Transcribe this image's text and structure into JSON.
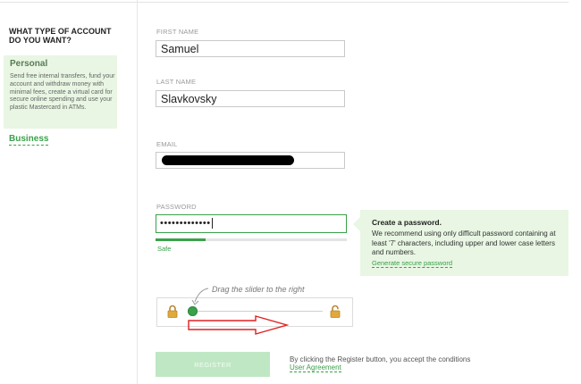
{
  "sidebar": {
    "heading": "WHAT TYPE OF ACCOUNT DO YOU WANT?",
    "options": [
      {
        "label": "Personal",
        "description": "Send free internal transfers, fund your account and withdraw money with minimal fees, create a virtual card for secure online spending and use your plastic Mastercard in ATMs.",
        "selected": true
      },
      {
        "label": "Business",
        "selected": false
      }
    ]
  },
  "form": {
    "first_name": {
      "label": "FIRST NAME",
      "value": "Samuel"
    },
    "last_name": {
      "label": "LAST NAME",
      "value": "Slavkovsky"
    },
    "email": {
      "label": "EMAIL",
      "value": ""
    },
    "password": {
      "label": "PASSWORD",
      "masked_value": "•••••••••••••",
      "strength_label": "Safe",
      "strength_fraction": 0.26
    }
  },
  "password_tip": {
    "title": "Create a password.",
    "text": "We recommend using only difficult password containing at least '7' characters, including upper and lower case letters and numbers.",
    "generate_link": "Generate secure password"
  },
  "captcha": {
    "hint": "Drag the slider to the right",
    "position_fraction": 0.0,
    "icons": [
      "lock-closed-icon",
      "lock-open-icon"
    ]
  },
  "register": {
    "button_label": "REGISTER",
    "terms_text": "By clicking the Register button, you accept the conditions",
    "terms_link": "User Agreement"
  },
  "colors": {
    "accent": "#3aa14a",
    "panel_bg": "#e8f6e3",
    "button_disabled": "#bfe7c4",
    "annotation_red": "#e02020"
  }
}
